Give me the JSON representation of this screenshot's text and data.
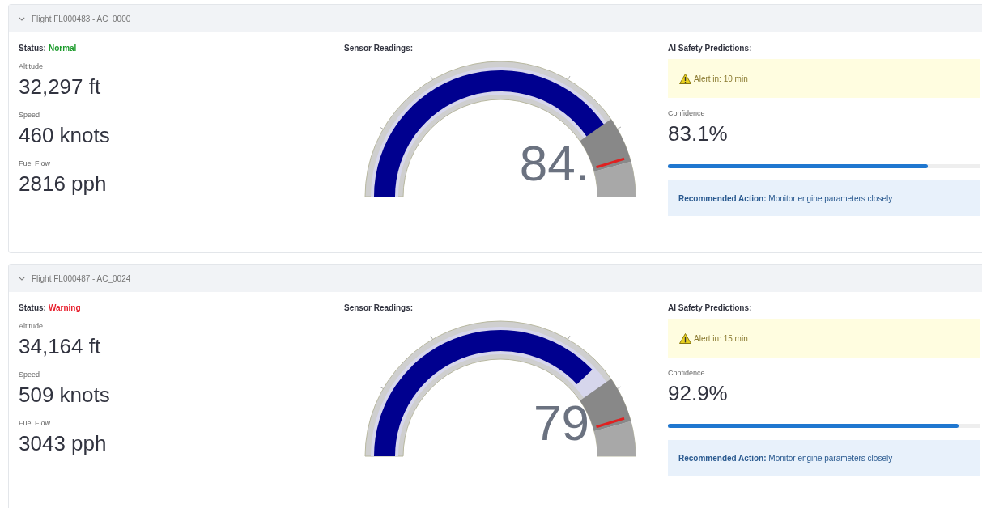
{
  "flights": [
    {
      "title": "Flight FL000483 - AC_0000",
      "expanded": true,
      "status_label": "Status:",
      "status": {
        "text": "Normal",
        "kind": "normal"
      },
      "metrics": [
        {
          "label": "Altitude",
          "value": "32,297 ft"
        },
        {
          "label": "Speed",
          "value": "460 knots"
        },
        {
          "label": "Fuel Flow",
          "value": "2816 pph"
        }
      ],
      "sensor_title": "Sensor Readings:",
      "gauge": {
        "value": "84."
      },
      "ai_title": "AI Safety Predictions:",
      "alert": "Alert in: 10 min",
      "confidence_label": "Confidence",
      "confidence": "83.1%",
      "level": 0.831,
      "action": "**Recommended Action:** Monitor engine parameters closely"
    },
    {
      "title": "Flight FL000487 - AC_0024",
      "expanded": true,
      "status_label": "Status:",
      "status": {
        "text": "Warning",
        "kind": "warning"
      },
      "metrics": [
        {
          "label": "Altitude",
          "value": "34,164 ft"
        },
        {
          "label": "Speed",
          "value": "509 knots"
        },
        {
          "label": "Fuel Flow",
          "value": "3043 pph"
        }
      ],
      "sensor_title": "Sensor Readings:",
      "gauge": {
        "value": "79"
      },
      "ai_title": "AI Safety Predictions:",
      "alert": "Alert in: 15 min",
      "confidence_label": "Confidence",
      "confidence": "92.9%",
      "level": 0.929,
      "action": "**Recommended Action:** Monitor engine parameters closely"
    }
  ]
}
